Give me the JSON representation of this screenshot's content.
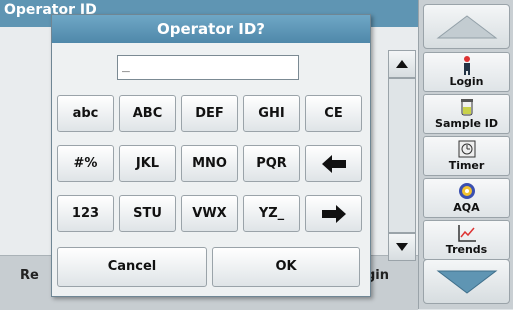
{
  "background": {
    "title": "Operator ID",
    "left_button": "Re",
    "right_button": "gin"
  },
  "sidebar": {
    "items": [
      {
        "label": "Login",
        "icon": "person-icon"
      },
      {
        "label": "Sample ID",
        "icon": "sample-vial-icon"
      },
      {
        "label": "Timer",
        "icon": "timer-icon"
      },
      {
        "label": "AQA",
        "icon": "aqa-icon"
      },
      {
        "label": "Trends",
        "icon": "trends-chart-icon"
      }
    ]
  },
  "dialog": {
    "title": "Operator ID?",
    "input_value": "_",
    "keys": [
      [
        "abc",
        "ABC",
        "DEF",
        "GHI",
        "CE"
      ],
      [
        "#%",
        "JKL",
        "MNO",
        "PQR",
        "backspace-arrow"
      ],
      [
        "123",
        "STU",
        "VWX",
        "YZ_",
        "enter-arrow"
      ]
    ],
    "cancel_label": "Cancel",
    "ok_label": "OK"
  }
}
